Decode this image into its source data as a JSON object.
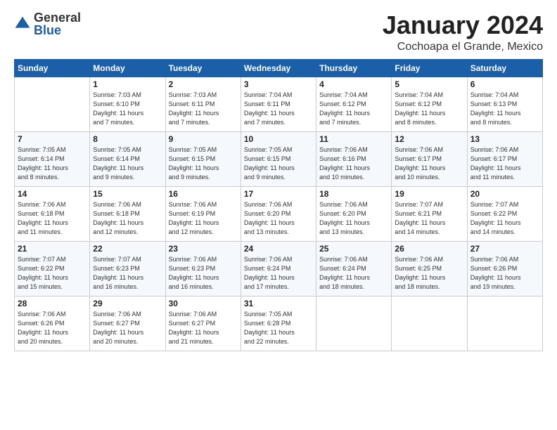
{
  "logo": {
    "general": "General",
    "blue": "Blue"
  },
  "title": "January 2024",
  "location": "Cochoapa el Grande, Mexico",
  "weekdays": [
    "Sunday",
    "Monday",
    "Tuesday",
    "Wednesday",
    "Thursday",
    "Friday",
    "Saturday"
  ],
  "weeks": [
    [
      {
        "day": "",
        "sunrise": "",
        "sunset": "",
        "daylight": ""
      },
      {
        "day": "1",
        "sunrise": "Sunrise: 7:03 AM",
        "sunset": "Sunset: 6:10 PM",
        "daylight": "Daylight: 11 hours and 7 minutes."
      },
      {
        "day": "2",
        "sunrise": "Sunrise: 7:03 AM",
        "sunset": "Sunset: 6:11 PM",
        "daylight": "Daylight: 11 hours and 7 minutes."
      },
      {
        "day": "3",
        "sunrise": "Sunrise: 7:04 AM",
        "sunset": "Sunset: 6:11 PM",
        "daylight": "Daylight: 11 hours and 7 minutes."
      },
      {
        "day": "4",
        "sunrise": "Sunrise: 7:04 AM",
        "sunset": "Sunset: 6:12 PM",
        "daylight": "Daylight: 11 hours and 7 minutes."
      },
      {
        "day": "5",
        "sunrise": "Sunrise: 7:04 AM",
        "sunset": "Sunset: 6:12 PM",
        "daylight": "Daylight: 11 hours and 8 minutes."
      },
      {
        "day": "6",
        "sunrise": "Sunrise: 7:04 AM",
        "sunset": "Sunset: 6:13 PM",
        "daylight": "Daylight: 11 hours and 8 minutes."
      }
    ],
    [
      {
        "day": "7",
        "sunrise": "Sunrise: 7:05 AM",
        "sunset": "Sunset: 6:14 PM",
        "daylight": "Daylight: 11 hours and 8 minutes."
      },
      {
        "day": "8",
        "sunrise": "Sunrise: 7:05 AM",
        "sunset": "Sunset: 6:14 PM",
        "daylight": "Daylight: 11 hours and 9 minutes."
      },
      {
        "day": "9",
        "sunrise": "Sunrise: 7:05 AM",
        "sunset": "Sunset: 6:15 PM",
        "daylight": "Daylight: 11 hours and 9 minutes."
      },
      {
        "day": "10",
        "sunrise": "Sunrise: 7:05 AM",
        "sunset": "Sunset: 6:15 PM",
        "daylight": "Daylight: 11 hours and 9 minutes."
      },
      {
        "day": "11",
        "sunrise": "Sunrise: 7:06 AM",
        "sunset": "Sunset: 6:16 PM",
        "daylight": "Daylight: 11 hours and 10 minutes."
      },
      {
        "day": "12",
        "sunrise": "Sunrise: 7:06 AM",
        "sunset": "Sunset: 6:17 PM",
        "daylight": "Daylight: 11 hours and 10 minutes."
      },
      {
        "day": "13",
        "sunrise": "Sunrise: 7:06 AM",
        "sunset": "Sunset: 6:17 PM",
        "daylight": "Daylight: 11 hours and 11 minutes."
      }
    ],
    [
      {
        "day": "14",
        "sunrise": "Sunrise: 7:06 AM",
        "sunset": "Sunset: 6:18 PM",
        "daylight": "Daylight: 11 hours and 11 minutes."
      },
      {
        "day": "15",
        "sunrise": "Sunrise: 7:06 AM",
        "sunset": "Sunset: 6:18 PM",
        "daylight": "Daylight: 11 hours and 12 minutes."
      },
      {
        "day": "16",
        "sunrise": "Sunrise: 7:06 AM",
        "sunset": "Sunset: 6:19 PM",
        "daylight": "Daylight: 11 hours and 12 minutes."
      },
      {
        "day": "17",
        "sunrise": "Sunrise: 7:06 AM",
        "sunset": "Sunset: 6:20 PM",
        "daylight": "Daylight: 11 hours and 13 minutes."
      },
      {
        "day": "18",
        "sunrise": "Sunrise: 7:06 AM",
        "sunset": "Sunset: 6:20 PM",
        "daylight": "Daylight: 11 hours and 13 minutes."
      },
      {
        "day": "19",
        "sunrise": "Sunrise: 7:07 AM",
        "sunset": "Sunset: 6:21 PM",
        "daylight": "Daylight: 11 hours and 14 minutes."
      },
      {
        "day": "20",
        "sunrise": "Sunrise: 7:07 AM",
        "sunset": "Sunset: 6:22 PM",
        "daylight": "Daylight: 11 hours and 14 minutes."
      }
    ],
    [
      {
        "day": "21",
        "sunrise": "Sunrise: 7:07 AM",
        "sunset": "Sunset: 6:22 PM",
        "daylight": "Daylight: 11 hours and 15 minutes."
      },
      {
        "day": "22",
        "sunrise": "Sunrise: 7:07 AM",
        "sunset": "Sunset: 6:23 PM",
        "daylight": "Daylight: 11 hours and 16 minutes."
      },
      {
        "day": "23",
        "sunrise": "Sunrise: 7:06 AM",
        "sunset": "Sunset: 6:23 PM",
        "daylight": "Daylight: 11 hours and 16 minutes."
      },
      {
        "day": "24",
        "sunrise": "Sunrise: 7:06 AM",
        "sunset": "Sunset: 6:24 PM",
        "daylight": "Daylight: 11 hours and 17 minutes."
      },
      {
        "day": "25",
        "sunrise": "Sunrise: 7:06 AM",
        "sunset": "Sunset: 6:24 PM",
        "daylight": "Daylight: 11 hours and 18 minutes."
      },
      {
        "day": "26",
        "sunrise": "Sunrise: 7:06 AM",
        "sunset": "Sunset: 6:25 PM",
        "daylight": "Daylight: 11 hours and 18 minutes."
      },
      {
        "day": "27",
        "sunrise": "Sunrise: 7:06 AM",
        "sunset": "Sunset: 6:26 PM",
        "daylight": "Daylight: 11 hours and 19 minutes."
      }
    ],
    [
      {
        "day": "28",
        "sunrise": "Sunrise: 7:06 AM",
        "sunset": "Sunset: 6:26 PM",
        "daylight": "Daylight: 11 hours and 20 minutes."
      },
      {
        "day": "29",
        "sunrise": "Sunrise: 7:06 AM",
        "sunset": "Sunset: 6:27 PM",
        "daylight": "Daylight: 11 hours and 20 minutes."
      },
      {
        "day": "30",
        "sunrise": "Sunrise: 7:06 AM",
        "sunset": "Sunset: 6:27 PM",
        "daylight": "Daylight: 11 hours and 21 minutes."
      },
      {
        "day": "31",
        "sunrise": "Sunrise: 7:05 AM",
        "sunset": "Sunset: 6:28 PM",
        "daylight": "Daylight: 11 hours and 22 minutes."
      },
      {
        "day": "",
        "sunrise": "",
        "sunset": "",
        "daylight": ""
      },
      {
        "day": "",
        "sunrise": "",
        "sunset": "",
        "daylight": ""
      },
      {
        "day": "",
        "sunrise": "",
        "sunset": "",
        "daylight": ""
      }
    ]
  ]
}
